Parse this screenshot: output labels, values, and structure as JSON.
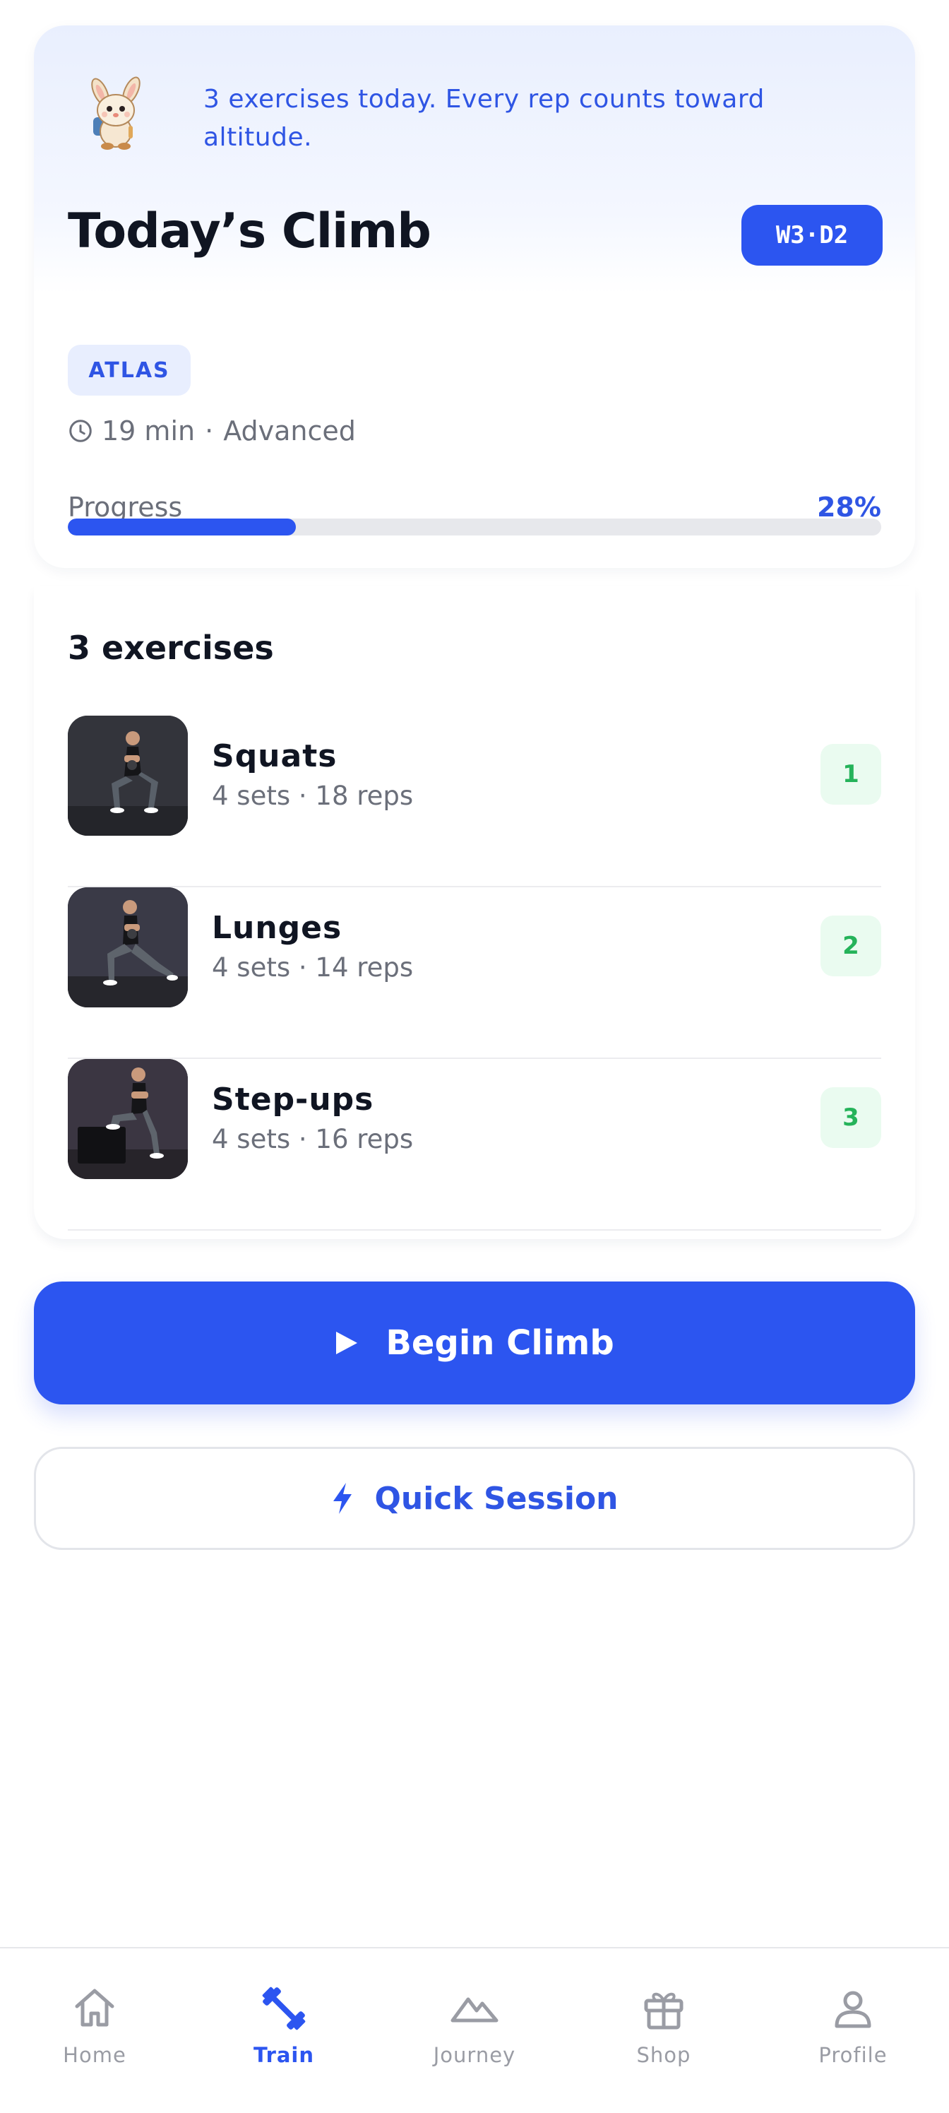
{
  "header": {
    "motivation": "3 exercises today. Every rep counts toward altitude.",
    "title": "Today’s Climb",
    "week_day_badge": "W3·D2",
    "mascot_icon": "bunny-hiker-mascot"
  },
  "workout": {
    "tag": "ATLAS",
    "duration": "19 min",
    "separator": "·",
    "level": "Advanced",
    "progress_label": "Progress",
    "progress_text": "28%",
    "progress_fraction": 0.28
  },
  "exercises": {
    "count_label": "3 exercises",
    "items": [
      {
        "name": "Squats",
        "detail": "4 sets · 18 reps",
        "order": "1"
      },
      {
        "name": "Lunges",
        "detail": "4 sets · 14 reps",
        "order": "2"
      },
      {
        "name": "Step-ups",
        "detail": "4 sets · 16 reps",
        "order": "3"
      }
    ]
  },
  "actions": {
    "primary": "Begin Climb",
    "secondary": "Quick Session"
  },
  "tabbar": {
    "items": [
      {
        "label": "Home",
        "icon": "home-icon",
        "active": false
      },
      {
        "label": "Train",
        "icon": "dumbbell-icon",
        "active": true
      },
      {
        "label": "Journey",
        "icon": "mountain-icon",
        "active": false
      },
      {
        "label": "Shop",
        "icon": "gift-icon",
        "active": false
      },
      {
        "label": "Profile",
        "icon": "user-icon",
        "active": false
      }
    ]
  },
  "colors": {
    "accent": "#2c55f0",
    "accent_text": "#2f55e4",
    "success": "#25b35a",
    "muted_text": "#6b6f7a"
  }
}
